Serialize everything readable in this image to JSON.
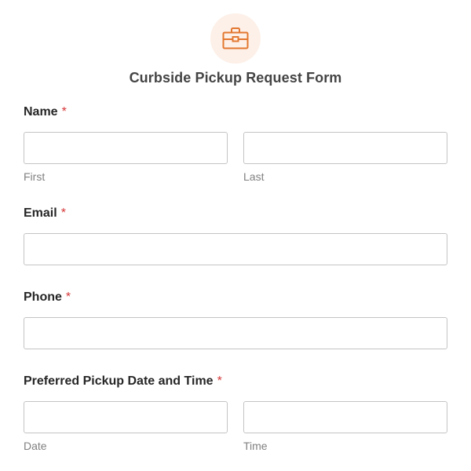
{
  "header": {
    "icon": "briefcase-icon",
    "icon_color": "#e27730",
    "badge_color": "#fdf0e8",
    "title": "Curbside Pickup Request Form"
  },
  "required_marker": "*",
  "required_color": "#d63638",
  "fields": {
    "name": {
      "label": "Name",
      "first_value": "",
      "last_value": "",
      "first_sublabel": "First",
      "last_sublabel": "Last"
    },
    "email": {
      "label": "Email",
      "value": ""
    },
    "phone": {
      "label": "Phone",
      "value": ""
    },
    "pickup": {
      "label": "Preferred Pickup Date and Time",
      "date_value": "",
      "time_value": "",
      "date_sublabel": "Date",
      "time_sublabel": "Time"
    }
  }
}
